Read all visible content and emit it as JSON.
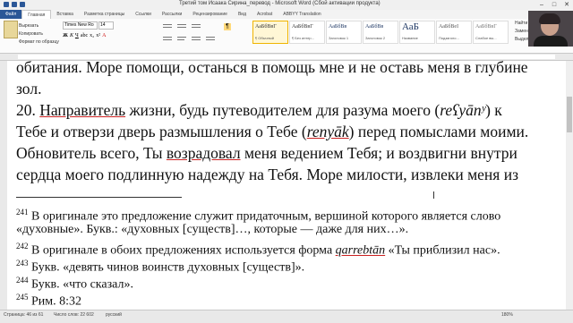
{
  "window": {
    "title": "Третий том Исаака Сирина_перевод - Microsoft Word (Сбой активации продукта)"
  },
  "tabs": [
    "Файл",
    "Главная",
    "Вставка",
    "Разметка страницы",
    "Ссылки",
    "Рассылки",
    "Рецензирование",
    "Вид",
    "Acrobat",
    "ABBYY Translation"
  ],
  "clipboard": {
    "paste": "Вставить",
    "cut": "Вырезать",
    "copy": "Копировать",
    "format": "Формат по образцу"
  },
  "font": {
    "name": "Times New Ro",
    "size": "14"
  },
  "styles": [
    {
      "sample": "АаБбВвГ",
      "name": "¶ Обычный"
    },
    {
      "sample": "АаБбВвГ",
      "name": "¶ Без интер..."
    },
    {
      "sample": "АаБбВв",
      "name": "Заголовок 1"
    },
    {
      "sample": "АаБбВв",
      "name": "Заголовок 2"
    },
    {
      "sample": "АаБ",
      "name": "Название"
    },
    {
      "sample": "АаБбВеІ",
      "name": "Подзаголо..."
    },
    {
      "sample": "АаБбВвГ",
      "name": "Слабое вы..."
    },
    {
      "sample": "АаБбВвГ",
      "name": "Выделение"
    }
  ],
  "editing": {
    "find": "Найти",
    "replace": "Заменить",
    "select": "Выделить"
  },
  "document": {
    "lines": [
      "обитания. Море помощи, останься в помощь мне и не оставь меня в глубине",
      "зол.",
      "",
      "Тебе и отверзи дверь размышления о Тебе (",
      "Обновитель всего, Ты",
      "сердца моего подлинную надежду на Тебя. Море милости, извлеки меня из"
    ],
    "p20_num": "20.",
    "p20_a": "Направитель",
    "p20_b": " жизни, будь путеводителем для разума моего (",
    "p20_c": "reʕyānʸ",
    "p20_d": ") к",
    "p20_e": "renyāk",
    "p20_f": ") перед помыслами моими.",
    "l5_a": "возрадовал",
    "l5_b": " меня ведением Тебя; и воздвигни внутри",
    "footnotes": [
      {
        "num": "241",
        "text": " В оригинале это предложение служит придаточным, вершиной которого является слово"
      },
      {
        "num": "",
        "text": "«духовные». Букв.: «духовных [существ]…, которые — даже для них…»."
      },
      {
        "num": "242",
        "text": " В оригинале в обоих предложениях используется форма ",
        "term": "qarrebtān",
        "rest": " «Ты приблизил нас»."
      },
      {
        "num": "243",
        "text": " Букв. «девять чинов воинств духовных [существ]»."
      },
      {
        "num": "244",
        "text": " Букв. «что сказал»."
      },
      {
        "num": "245",
        "text": " Рим. 8:32"
      }
    ]
  },
  "status": {
    "page": "Страница: 46 из 61",
    "words": "Число слов: 22 602",
    "lang": "русский",
    "zoom": "180%"
  },
  "colors": {
    "file_tab": "#2b5797",
    "ribbon": "#fbfbfb",
    "selected_style": "#fff7d6"
  }
}
